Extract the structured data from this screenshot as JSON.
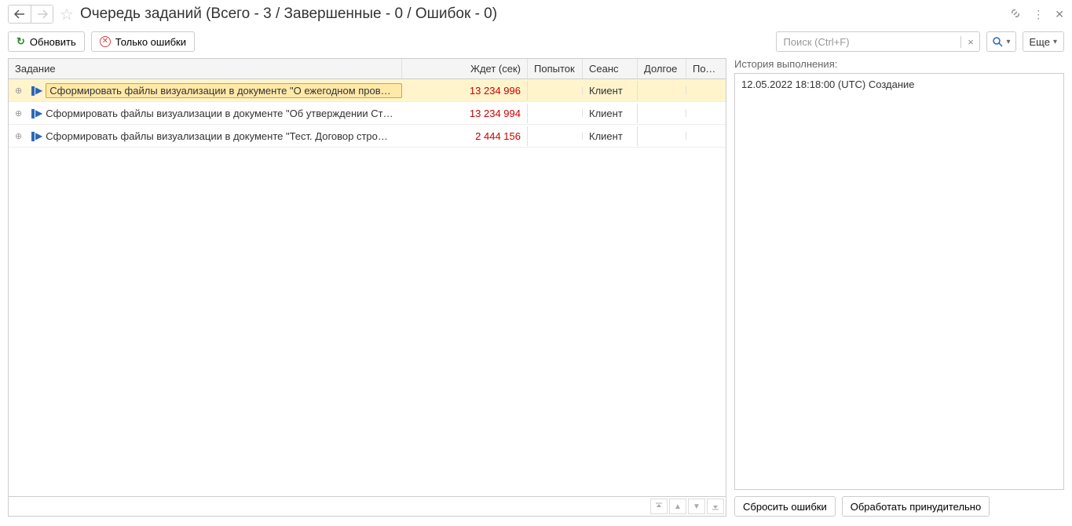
{
  "title": "Очередь заданий (Всего - 3 / Завершенные - 0 / Ошибок - 0)",
  "toolbar": {
    "refresh": "Обновить",
    "errors_only": "Только ошибки",
    "search_placeholder": "Поиск (Ctrl+F)",
    "more": "Еще"
  },
  "columns": {
    "task": "Задание",
    "wait": "Ждет (сек)",
    "attempts": "Попыток",
    "session": "Сеанс",
    "long": "Долгое",
    "thread": "Поток"
  },
  "rows": [
    {
      "task": "Сформировать файлы визуализации в документе \"О ежегодном пров…",
      "wait": "13 234 996",
      "session": "Клиент",
      "selected": true
    },
    {
      "task": "Сформировать файлы визуализации в документе \"Об утверждении Ст…",
      "wait": "13 234 994",
      "session": "Клиент",
      "selected": false
    },
    {
      "task": "Сформировать файлы визуализации в документе \"Тест. Договор стро…",
      "wait": "2 444 156",
      "session": "Клиент",
      "selected": false
    }
  ],
  "history": {
    "label": "История выполнения:",
    "entry": "12.05.2022 18:18:00 (UTC) Создание"
  },
  "actions": {
    "reset_errors": "Сбросить ошибки",
    "force_process": "Обработать принудительно"
  }
}
